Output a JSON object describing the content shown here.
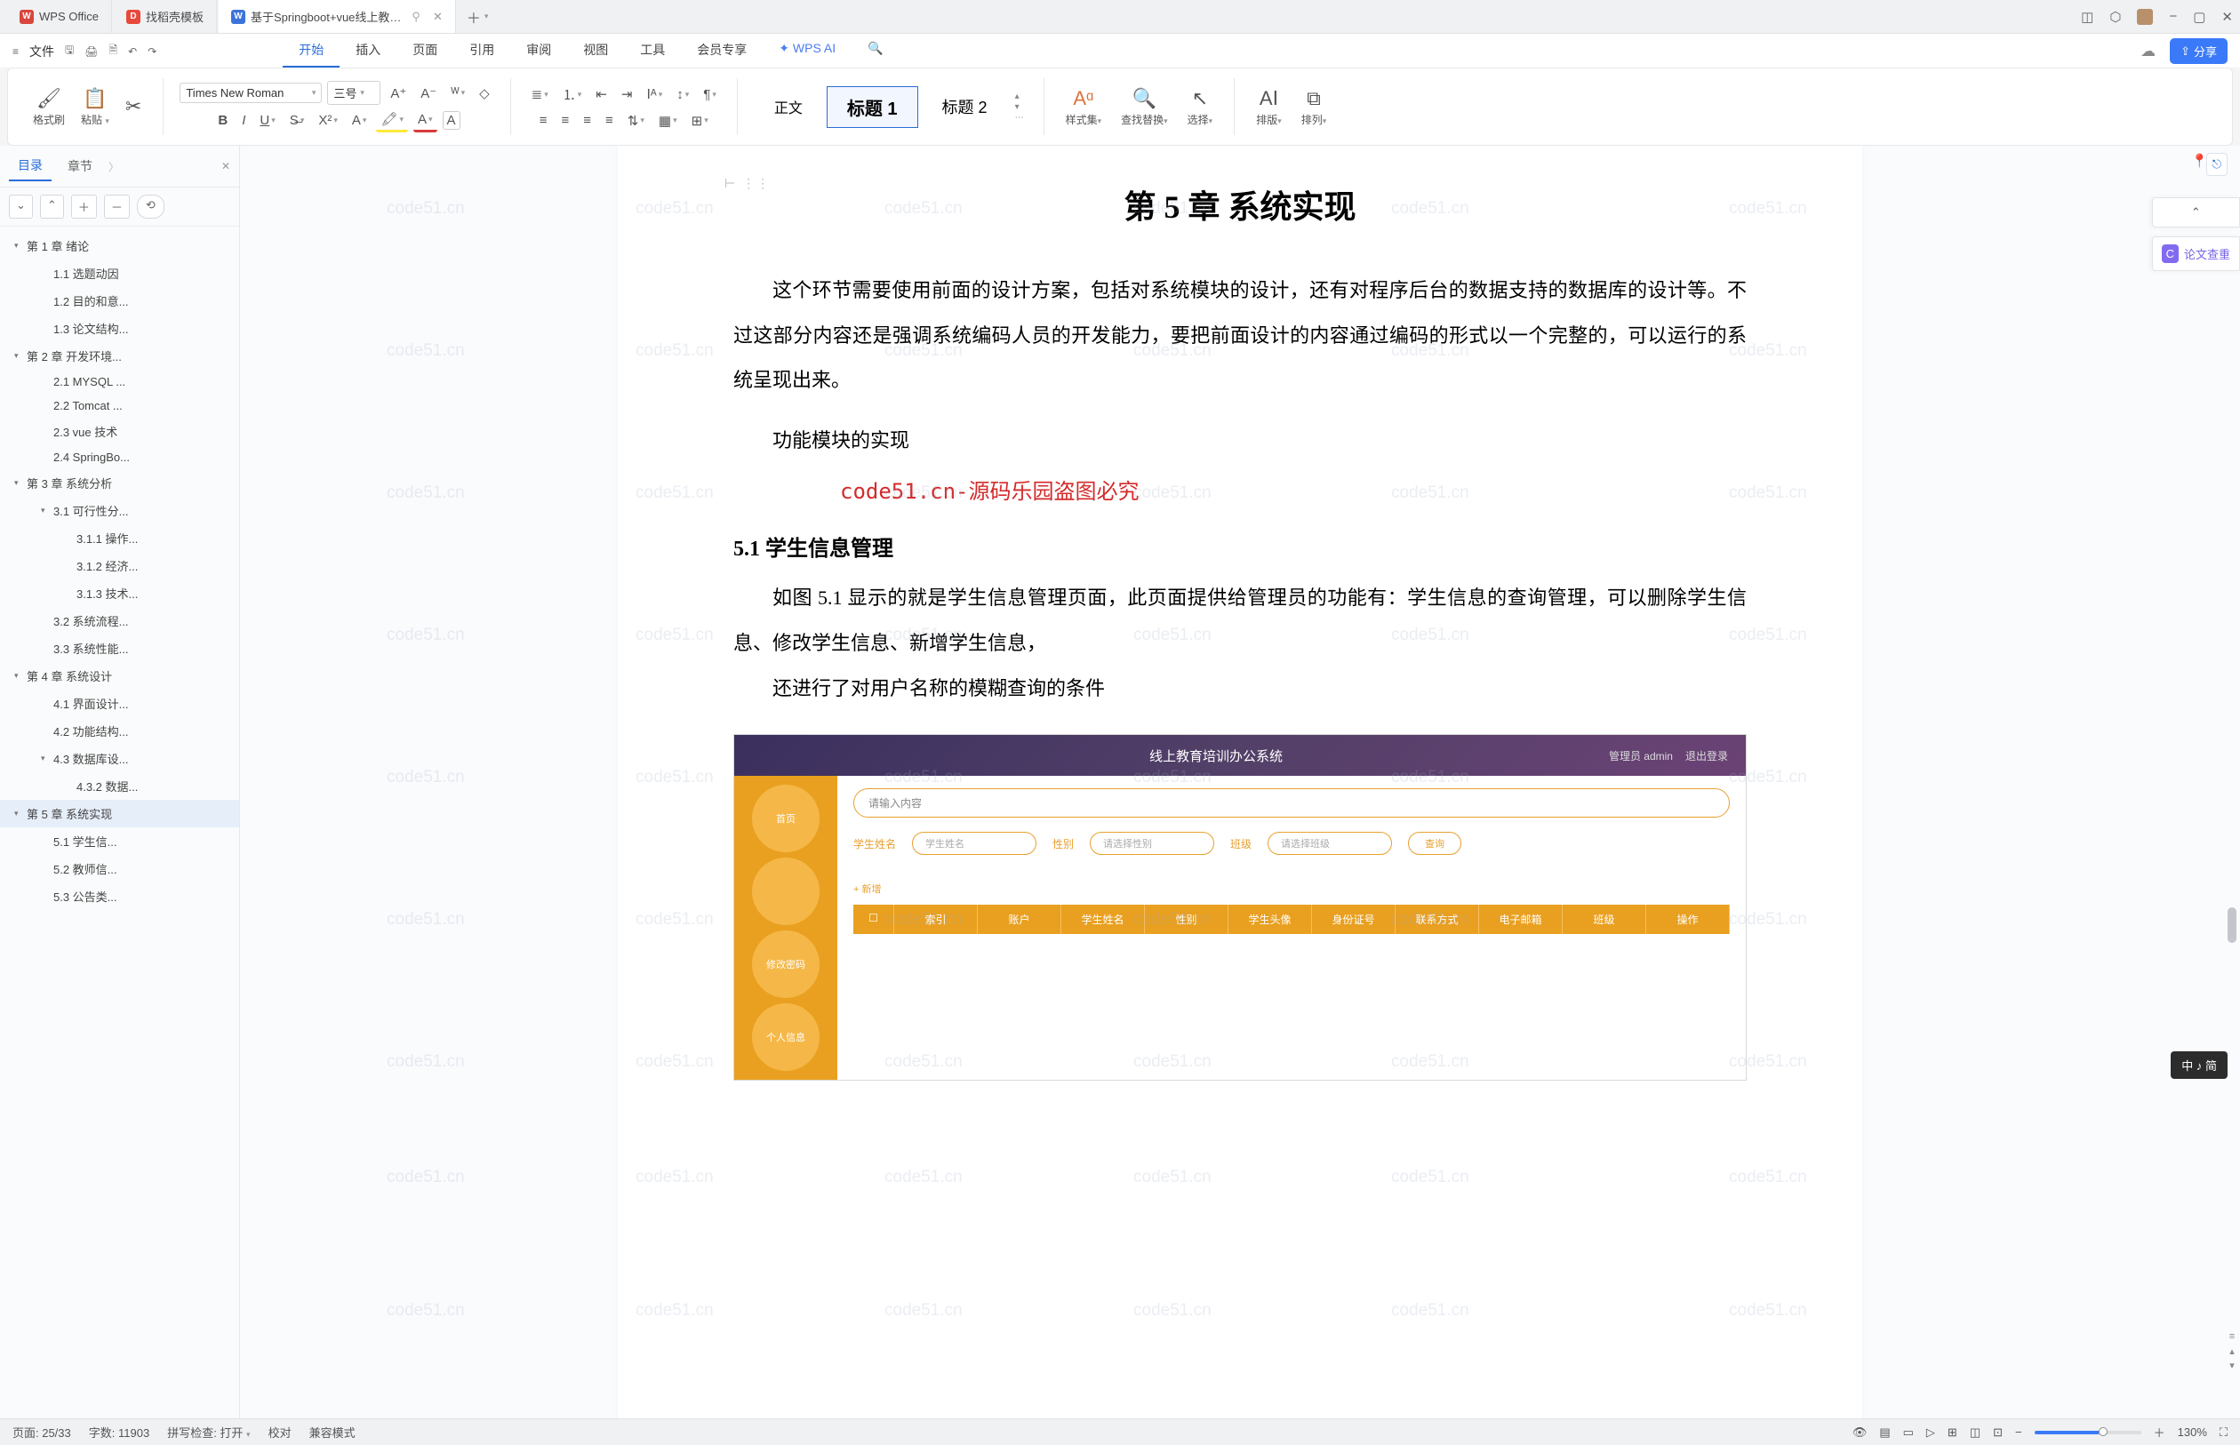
{
  "titlebar": {
    "tabs": [
      {
        "icon_bg": "#d9463d",
        "icon_text": "W",
        "label": "WPS Office"
      },
      {
        "icon_bg": "#e74a3c",
        "icon_text": "D",
        "label": "找稻壳模板"
      },
      {
        "icon_bg": "#3d73d9",
        "icon_text": "W",
        "label": "基于Springboot+vue线上教…"
      }
    ],
    "controls": {
      "minimize": "−",
      "maximize": "▢",
      "close": "✕"
    }
  },
  "menubar": {
    "file": "文件",
    "tabs": [
      "开始",
      "插入",
      "页面",
      "引用",
      "审阅",
      "视图",
      "工具",
      "会员专享"
    ],
    "ai": "WPS AI",
    "share": "分享"
  },
  "ribbon": {
    "fmt_brush": "格式刷",
    "paste": "粘贴",
    "font_name": "Times New Roman",
    "font_size": "三号",
    "style_body": "正文",
    "style_h1": "标题 1",
    "style_h2": "标题 2",
    "style_set": "样式集",
    "find_replace": "查找替换",
    "select": "选择",
    "arrange": "排版",
    "arrange2": "排列"
  },
  "sidebar": {
    "tab_toc": "目录",
    "tab_chapter": "章节",
    "toc": [
      {
        "lvl": 1,
        "t": "第 1 章  绪论",
        "caret": true
      },
      {
        "lvl": 2,
        "t": "1.1 选题动因"
      },
      {
        "lvl": 2,
        "t": "1.2 目的和意..."
      },
      {
        "lvl": 2,
        "t": "1.3 论文结构..."
      },
      {
        "lvl": 1,
        "t": "第 2 章  开发环境...",
        "caret": true
      },
      {
        "lvl": 2,
        "t": "2.1 MYSQL ..."
      },
      {
        "lvl": 2,
        "t": "2.2 Tomcat ..."
      },
      {
        "lvl": 2,
        "t": "2.3 vue 技术"
      },
      {
        "lvl": 2,
        "t": "2.4 SpringBo..."
      },
      {
        "lvl": 1,
        "t": "第 3 章  系统分析",
        "caret": true
      },
      {
        "lvl": 2,
        "t": "3.1 可行性分...",
        "caret": true
      },
      {
        "lvl": 3,
        "t": "3.1.1 操作..."
      },
      {
        "lvl": 3,
        "t": "3.1.2 经济..."
      },
      {
        "lvl": 3,
        "t": "3.1.3 技术..."
      },
      {
        "lvl": 2,
        "t": "3.2 系统流程..."
      },
      {
        "lvl": 2,
        "t": "3.3 系统性能..."
      },
      {
        "lvl": 1,
        "t": "第 4 章  系统设计",
        "caret": true
      },
      {
        "lvl": 2,
        "t": "4.1 界面设计..."
      },
      {
        "lvl": 2,
        "t": "4.2 功能结构..."
      },
      {
        "lvl": 2,
        "t": "4.3 数据库设...",
        "caret": true
      },
      {
        "lvl": 3,
        "t": "4.3.2  数据..."
      },
      {
        "lvl": 1,
        "t": "第 5 章  系统实现",
        "caret": true,
        "sel": true
      },
      {
        "lvl": 2,
        "t": "5.1 学生信..."
      },
      {
        "lvl": 2,
        "t": "5.2 教师信..."
      },
      {
        "lvl": 2,
        "t": "5.3 公告类..."
      }
    ]
  },
  "document": {
    "page_marks": "⊢ ⋮⋮",
    "watermark": "code51.cn",
    "chapter_title": "第 5 章  系统实现",
    "para1": "这个环节需要使用前面的设计方案，包括对系统模块的设计，还有对程序后台的数据支持的数据库的设计等。不过这部分内容还是强调系统编码人员的开发能力，要把前面设计的内容通过编码的形式以一个完整的，可以运行的系统呈现出来。",
    "subtitle": "功能模块的实现",
    "redline": "code51.cn-源码乐园盗图必究",
    "sec51": "5.1 学生信息管理",
    "para2": "如图 5.1 显示的就是学生信息管理页面，此页面提供给管理员的功能有：学生信息的查询管理，可以删除学生信息、修改学生信息、新增学生信息，",
    "para3": "还进行了对用户名称的模糊查询的条件"
  },
  "embedded": {
    "header_title": "线上教育培训办公系统",
    "header_user": "管理员 admin",
    "header_logout": "退出登录",
    "circle1": "首页",
    "circle2": "",
    "circle3": "修改密码",
    "circle4": "个人信息",
    "search_placeholder": "请输入内容",
    "f1_label": "学生姓名",
    "f1_ph": "学生姓名",
    "f2_label": "性别",
    "f2_ph": "请选择性别",
    "f3_label": "班级",
    "f3_ph": "请选择班级",
    "btn_query": "查询",
    "btn_add": "+ 新增",
    "th": [
      "",
      "索引",
      "账户",
      "学生姓名",
      "性别",
      "学生头像",
      "身份证号",
      "联系方式",
      "电子邮箱",
      "班级",
      "操作"
    ]
  },
  "right": {
    "duplicate_check": "论文查重"
  },
  "ime": "中 ♪ 简",
  "statusbar": {
    "page": "页面: 25/33",
    "words": "字数: 11903",
    "spell": "拼写检查: 打开",
    "proof": "校对",
    "compat": "兼容模式",
    "zoom": "130%"
  }
}
